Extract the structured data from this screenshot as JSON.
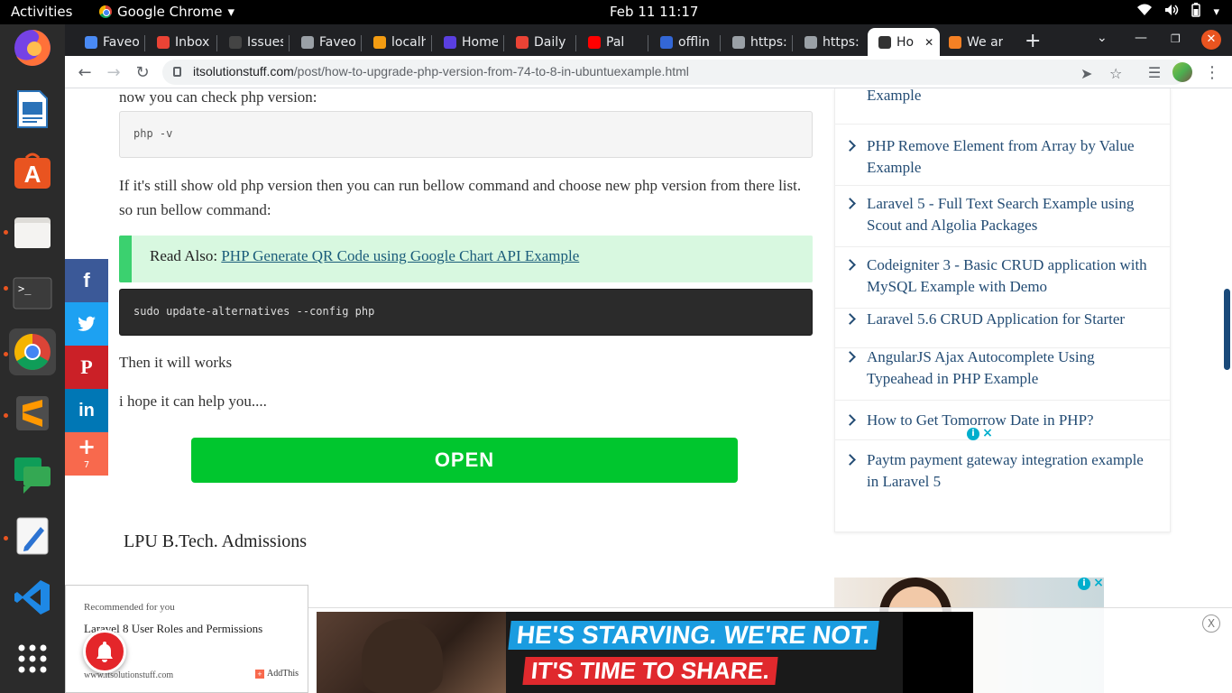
{
  "topbar": {
    "activities": "Activities",
    "app_name": "Google Chrome",
    "clock": "Feb 11  11:17"
  },
  "tabs": [
    {
      "label": "Faveo",
      "icon": "plus-icon",
      "color": "#4a8af4"
    },
    {
      "label": "Inbox",
      "icon": "gmail-icon",
      "color": "#ea4335"
    },
    {
      "label": "Issues",
      "icon": "github-icon",
      "color": "#444444"
    },
    {
      "label": "Faveo",
      "icon": "globe-icon",
      "color": "#9aa0a6"
    },
    {
      "label": "localh",
      "icon": "pma-icon",
      "color": "#f39c12"
    },
    {
      "label": "Home",
      "icon": "k-icon",
      "color": "#5a3fe0"
    },
    {
      "label": "Daily",
      "icon": "gmail-icon",
      "color": "#ea4335"
    },
    {
      "label": "Pal",
      "icon": "youtube-icon",
      "color": "#ff0000"
    },
    {
      "label": "offlin",
      "icon": "doc-icon",
      "color": "#3367d6"
    },
    {
      "label": "https:",
      "icon": "globe-icon",
      "color": "#9aa0a6"
    },
    {
      "label": "https:",
      "icon": "globe-icon",
      "color": "#9aa0a6"
    },
    {
      "label": "Ho",
      "icon": "site-icon",
      "color": "#333333",
      "active": true
    },
    {
      "label": "We ar",
      "icon": "so-icon",
      "color": "#f48024"
    }
  ],
  "omnibox": {
    "host": "itsolutionstuff.com",
    "path": "/post/how-to-upgrade-php-version-from-74-to-8-in-ubuntuexample.html"
  },
  "article": {
    "check_intro": "now you can check php version:",
    "code1": "php -v",
    "para2": "If it's still show old php version then you can run bellow command and choose new php version from there list. so run bellow command:",
    "read_also_label": "Read Also:",
    "read_also_link": "PHP Generate QR Code using Google Chart API Example",
    "code2": "sudo update-alternatives --config php",
    "para3": "Then it will works",
    "para4": "i hope it can help you....",
    "open_button": "OPEN",
    "lpu": "LPU B.Tech. Admissions"
  },
  "share": {
    "count": "7",
    "colors": {
      "facebook": "#3b5998",
      "twitter": "#1da1f2",
      "pinterest": "#cb2027",
      "linkedin": "#0077b5",
      "more": "#f8694d"
    }
  },
  "sidebar": {
    "items": [
      "Example",
      "PHP Remove Element from Array by Value Example",
      "Laravel 5 - Full Text Search Example using Scout and Algolia Packages",
      "Codeigniter 3 - Basic CRUD application with MySQL Example with Demo",
      "Laravel 5.6 CRUD Application for Starter",
      "AngularJS Ajax Autocomplete Using Typeahead in PHP Example",
      "How to Get Tomorrow Date in PHP?",
      "Paytm payment gateway integration example in Laravel 5"
    ]
  },
  "recommend": {
    "heading": "Recommended for you",
    "title": "Laravel 8 User Roles and Permissions",
    "site": "www.itsolutionstuff.com",
    "addthis": "AddThis"
  },
  "ad": {
    "line1": "HE'S STARVING. WE'RE NOT.",
    "line2": "IT'S TIME TO SHARE.",
    "close": "X"
  }
}
